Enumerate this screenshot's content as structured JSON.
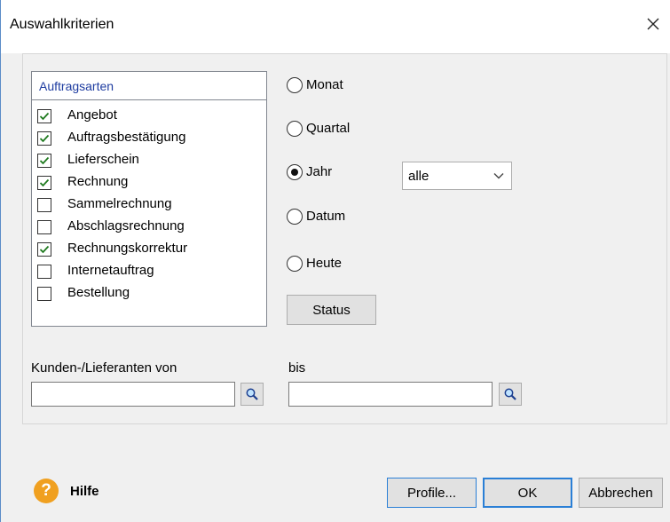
{
  "window": {
    "title": "Auswahlkriterien"
  },
  "list": {
    "header": "Auftragsarten",
    "items": [
      {
        "label": "Angebot",
        "checked": true
      },
      {
        "label": "Auftragsbestätigung",
        "checked": true
      },
      {
        "label": "Lieferschein",
        "checked": true
      },
      {
        "label": "Rechnung",
        "checked": true
      },
      {
        "label": "Sammelrechnung",
        "checked": false
      },
      {
        "label": "Abschlagsrechnung",
        "checked": false
      },
      {
        "label": "Rechnungskorrektur",
        "checked": true
      },
      {
        "label": "Internetauftrag",
        "checked": false
      },
      {
        "label": "Bestellung",
        "checked": false
      }
    ]
  },
  "period": {
    "options": [
      {
        "label": "Monat",
        "selected": false
      },
      {
        "label": "Quartal",
        "selected": false
      },
      {
        "label": "Jahr",
        "selected": true
      },
      {
        "label": "Datum",
        "selected": false
      },
      {
        "label": "Heute",
        "selected": false
      }
    ],
    "year_select": "alle",
    "status_button": "Status"
  },
  "range": {
    "from_label": "Kunden-/Lieferanten von",
    "from_value": "",
    "to_label": "bis",
    "to_value": ""
  },
  "footer": {
    "help": "Hilfe",
    "profile_button": "Profile...",
    "ok_button": "OK",
    "cancel_button": "Abbrechen"
  },
  "colors": {
    "accent": "#2a7fd6",
    "help": "#f0a020",
    "header": "#1e3ca0"
  },
  "icons": {
    "close": "close-icon",
    "search": "search-icon",
    "help": "help-icon",
    "check": "check-icon",
    "dropdown": "chevron-down-icon"
  }
}
